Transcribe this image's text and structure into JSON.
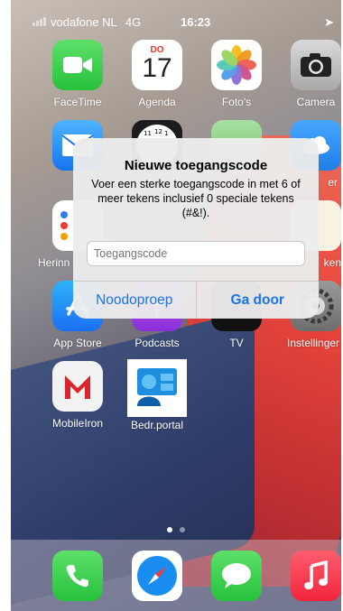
{
  "status": {
    "carrier": "vodafone NL",
    "network": "4G",
    "time": "16:23"
  },
  "apps": {
    "facetime": "FaceTime",
    "agenda": "Agenda",
    "agenda_day": "DO",
    "agenda_date": "17",
    "fotos": "Foto's",
    "camera": "Camera",
    "mail_partial": "M",
    "weer_partial": "er",
    "herinneringen_partial": "Herinn",
    "notities_partial": "ken",
    "appstore": "App Store",
    "podcasts": "Podcasts",
    "tv": "TV",
    "instellingen": "Instellinger",
    "mobileiron": "MobileIron",
    "bedrportal": "Bedr.portal"
  },
  "alert": {
    "title": "Nieuwe toegangscode",
    "message": "Voer een sterke toegangscode in met 6 of meer tekens inclusief 0 speciale tekens (#&!).",
    "placeholder": "Toegangscode",
    "emergency_label": "Noodoproep",
    "continue_label": "Ga door"
  },
  "colors": {
    "accent": "#1a73e8"
  }
}
